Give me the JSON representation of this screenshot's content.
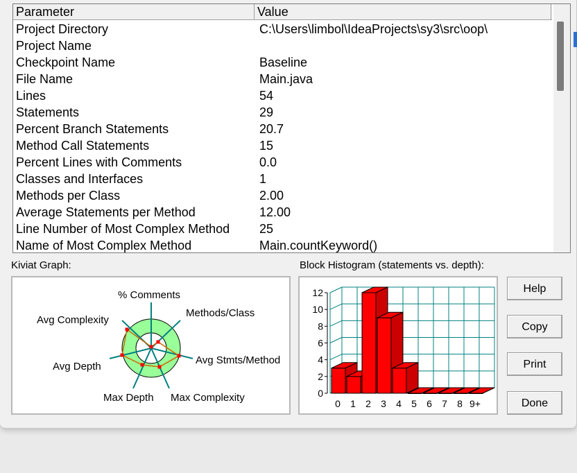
{
  "table": {
    "columns": [
      "Parameter",
      "Value"
    ],
    "rows": [
      {
        "param": "Project Directory",
        "value": "C:\\Users\\limbol\\IdeaProjects\\sy3\\src\\oop\\"
      },
      {
        "param": "Project Name",
        "value": ""
      },
      {
        "param": "Checkpoint Name",
        "value": "Baseline"
      },
      {
        "param": "File Name",
        "value": "Main.java"
      },
      {
        "param": "Lines",
        "value": "54"
      },
      {
        "param": "Statements",
        "value": "29"
      },
      {
        "param": "Percent Branch Statements",
        "value": "20.7"
      },
      {
        "param": "Method Call Statements",
        "value": "15"
      },
      {
        "param": "Percent Lines with Comments",
        "value": "0.0"
      },
      {
        "param": "Classes and Interfaces",
        "value": "1"
      },
      {
        "param": "Methods per Class",
        "value": "2.00"
      },
      {
        "param": "Average Statements per Method",
        "value": "12.00"
      },
      {
        "param": "Line Number of Most Complex Method",
        "value": "25"
      },
      {
        "param": "Name of Most Complex Method",
        "value": "Main.countKeyword()"
      }
    ]
  },
  "kiviat": {
    "label": "Kiviat Graph:",
    "axes": [
      "% Comments",
      "Methods/Class",
      "Avg Stmts/Method",
      "Max Complexity",
      "Max Depth",
      "Avg Depth",
      "Avg Complexity"
    ]
  },
  "histogram": {
    "label": "Block Histogram (statements vs. depth):"
  },
  "buttons": {
    "help": "Help",
    "copy": "Copy",
    "print": "Print",
    "done": "Done"
  },
  "colors": {
    "bar": "#ff0000",
    "grid": "#008080",
    "ring": "#99ff99"
  },
  "chart_data": {
    "type": "bar",
    "categories": [
      "0",
      "1",
      "2",
      "3",
      "4",
      "5",
      "6",
      "7",
      "8",
      "9+"
    ],
    "values": [
      3,
      2,
      12,
      9,
      3,
      0,
      0,
      0,
      0,
      0
    ],
    "yticks": [
      "0",
      "2",
      "4",
      "6",
      "8",
      "10",
      "12"
    ],
    "ylim": [
      0,
      12
    ],
    "grid": true
  }
}
